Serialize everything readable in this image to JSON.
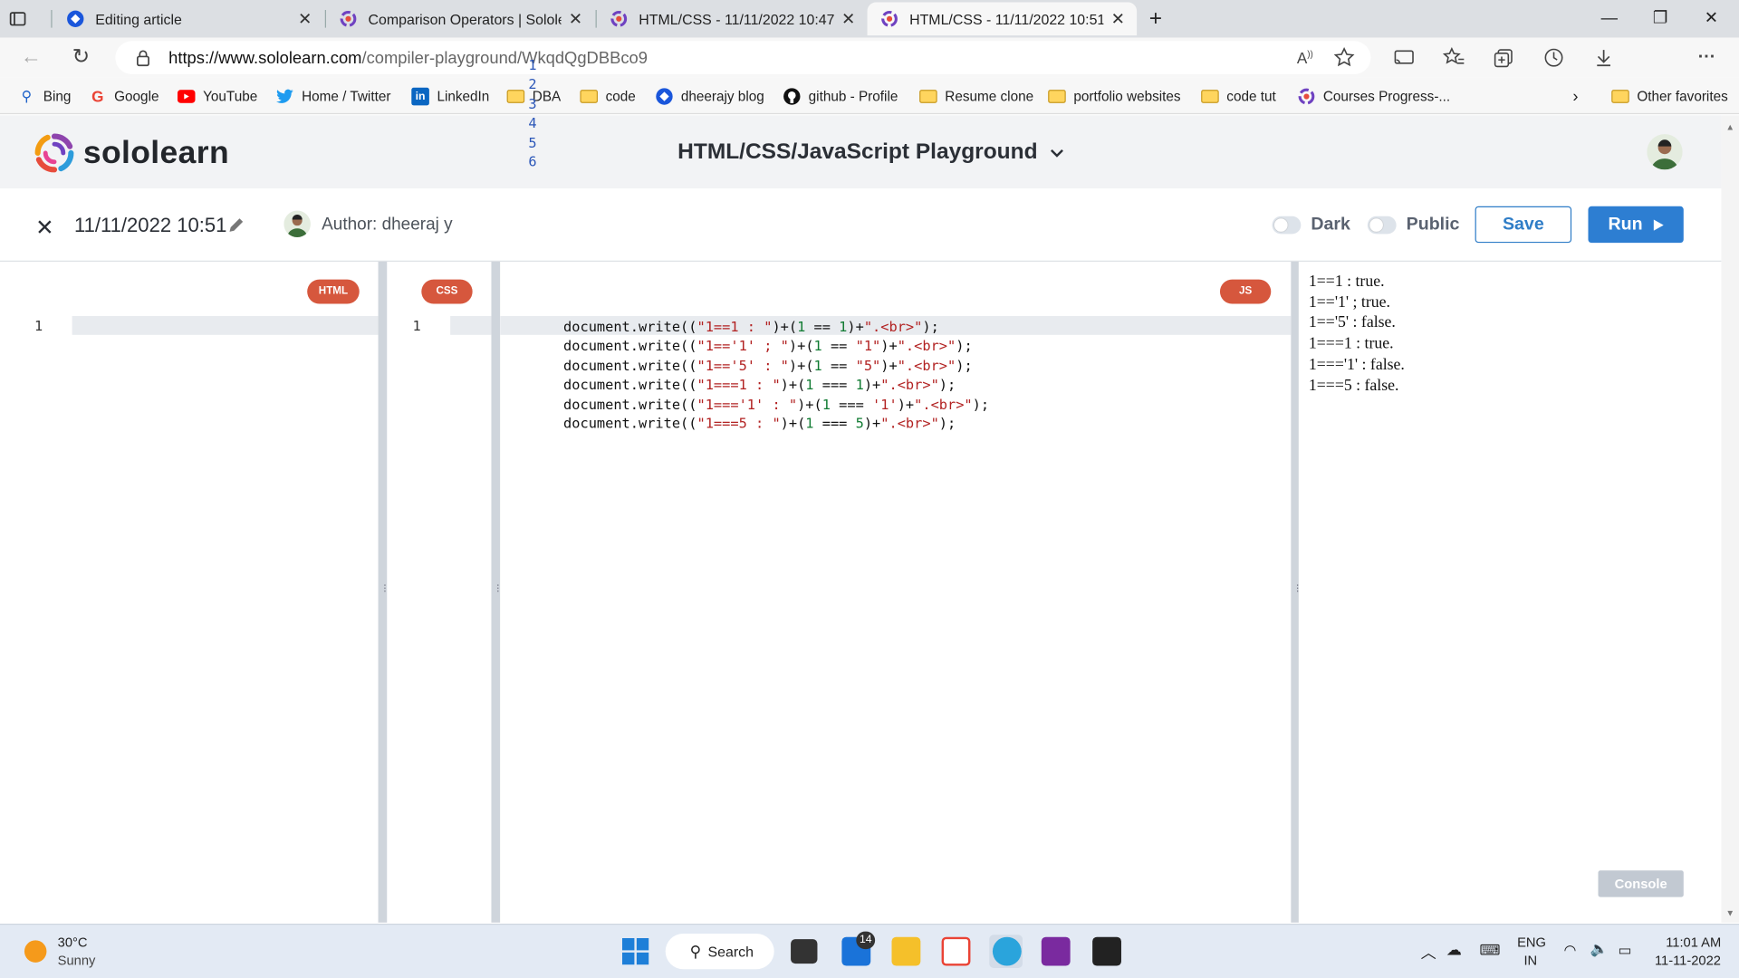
{
  "browser": {
    "tabs": [
      {
        "title": "Editing article"
      },
      {
        "title": "Comparison Operators | Sololearn"
      },
      {
        "title": "HTML/CSS - 11/11/2022 10:47 C"
      },
      {
        "title": "HTML/CSS - 11/11/2022 10:51 C"
      }
    ],
    "url_domain": "https://www.sololearn.com",
    "url_path": "/compiler-playground/WkqdQgDBBco9",
    "bookmarks": [
      "Bing",
      "Google",
      "YouTube",
      "Home / Twitter",
      "LinkedIn",
      "DBA",
      "code",
      "dheerajy blog",
      "github - Profile",
      "Resume clone",
      "portfolio websites",
      "code tut",
      "Courses Progress-..."
    ],
    "other_favorites": "Other favorites"
  },
  "app": {
    "logo_text": "sololearn",
    "playground_title": "HTML/CSS/JavaScript Playground",
    "code_date": "11/11/2022 10:51",
    "author": "Author: dheeraj y",
    "dark_label": "Dark",
    "public_label": "Public",
    "save_label": "Save",
    "run_label": "Run",
    "badges": {
      "html": "HTML",
      "css": "CSS",
      "js": "JS"
    },
    "html_line": "1",
    "css_line": "1",
    "js_lines": [
      "1",
      "2",
      "3",
      "4",
      "5",
      "6"
    ],
    "output": [
      "1==1 : true.",
      "1=='1' ; true.",
      "1=='5' : false.",
      "1===1 : true.",
      "1==='1' : false.",
      "1===5 : false."
    ],
    "console_label": "Console"
  },
  "taskbar": {
    "temp": "30°C",
    "weather": "Sunny",
    "search": "Search",
    "mail_badge": "14",
    "lang": "ENG",
    "region": "IN",
    "time": "11:01 AM",
    "date": "11-11-2022"
  }
}
